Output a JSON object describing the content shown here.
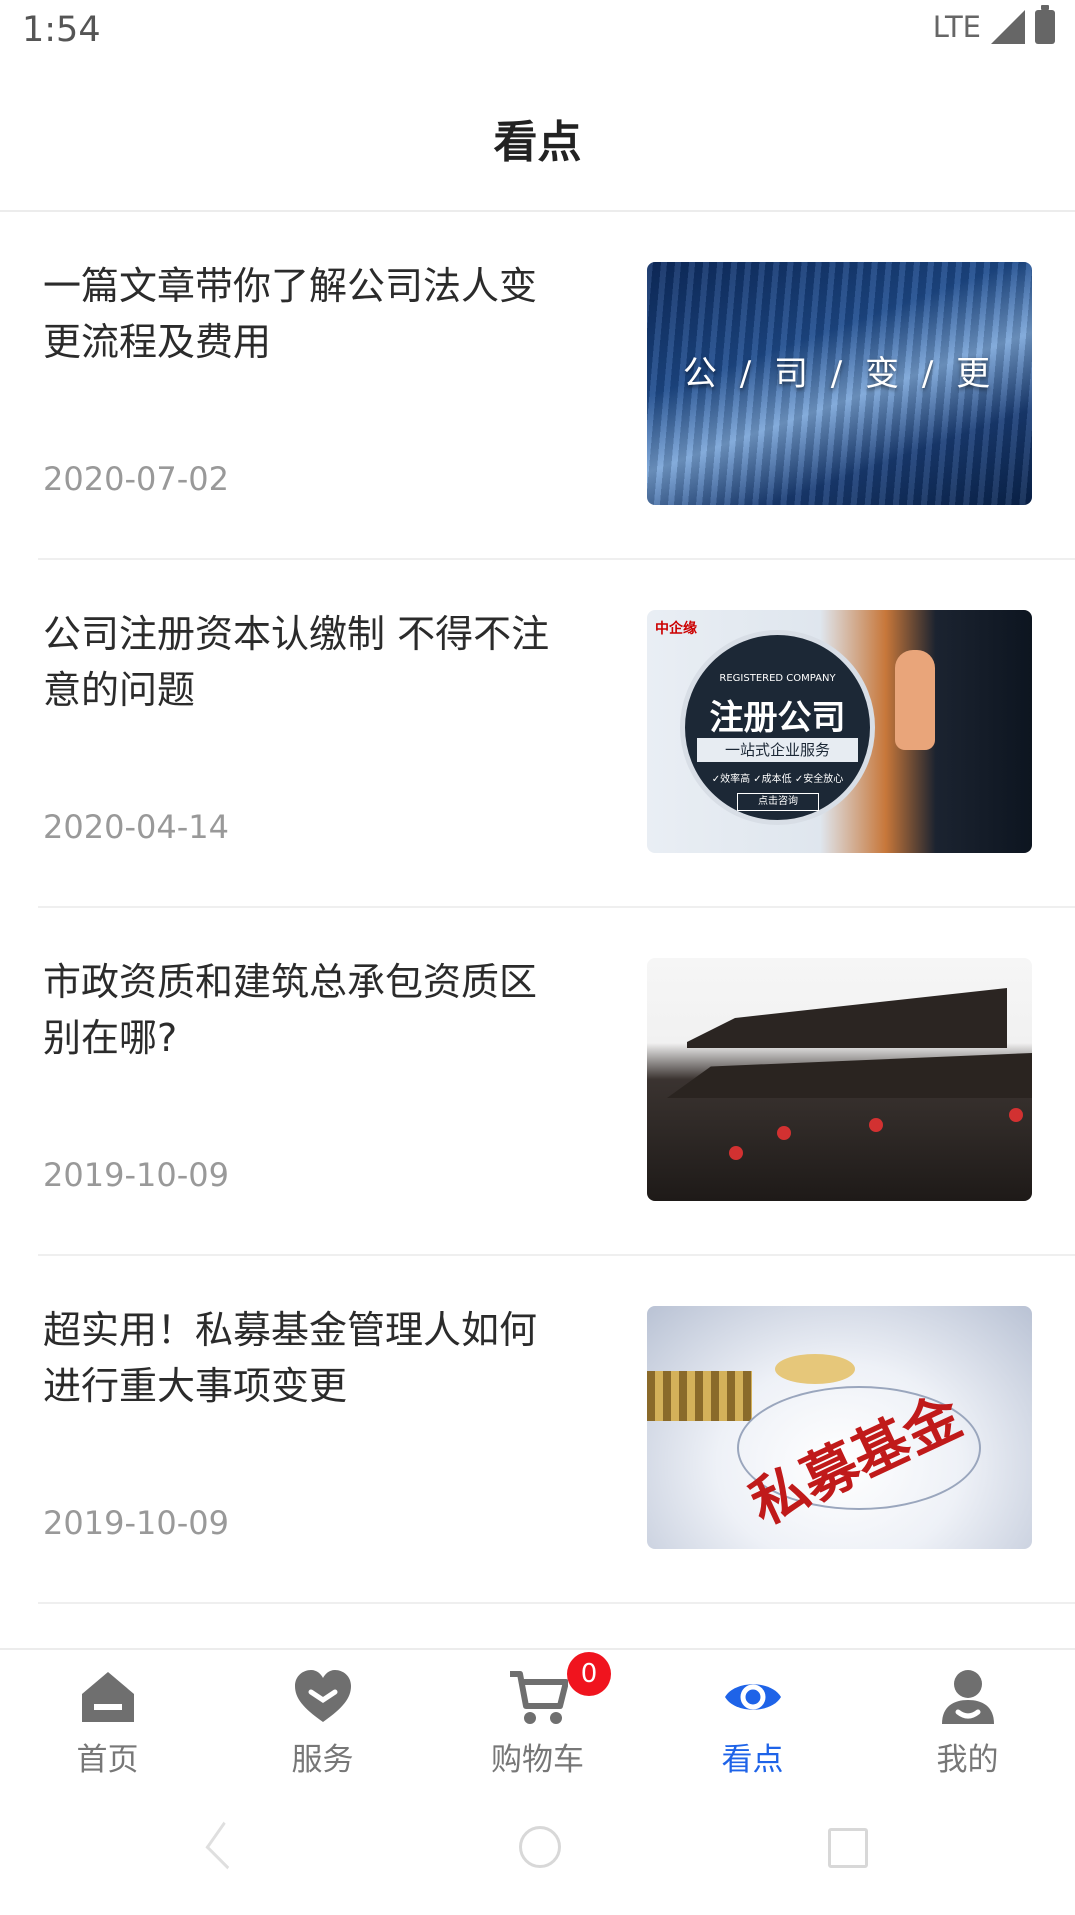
{
  "status_bar": {
    "time": "1:54",
    "network": "LTE"
  },
  "header": {
    "title": "看点"
  },
  "articles": [
    {
      "title": "一篇文章带你了解公司法人变更流程及费用",
      "date": "2020-07-02",
      "thumb_caption": "公 / 司 / 变 / 更"
    },
    {
      "title": "公司注册资本认缴制 不得不注意的问题",
      "date": "2020-04-14",
      "thumb_caption": "注册公司",
      "thumb_sub": "一站式企业服务",
      "thumb_reg": "REGISTERED COMPANY",
      "thumb_logo": "中企缘",
      "thumb_features": "✓效率高 ✓成本低 ✓安全放心",
      "thumb_button": "点击咨询"
    },
    {
      "title": "市政资质和建筑总承包资质区别在哪?",
      "date": "2019-10-09"
    },
    {
      "title": "超实用！私募基金管理人如何进行重大事项变更",
      "date": "2019-10-09",
      "thumb_caption": "私募基金"
    }
  ],
  "tabbar": {
    "tabs": [
      {
        "label": "首页",
        "icon": "home-icon",
        "active": false
      },
      {
        "label": "服务",
        "icon": "heart-icon",
        "active": false
      },
      {
        "label": "购物车",
        "icon": "cart-icon",
        "active": false,
        "badge": "0"
      },
      {
        "label": "看点",
        "icon": "eye-icon",
        "active": true
      },
      {
        "label": "我的",
        "icon": "user-icon",
        "active": false
      }
    ]
  },
  "colors": {
    "accent": "#1e63e8",
    "inactive_icon": "#6f6f6f",
    "badge": "#f0141e"
  }
}
